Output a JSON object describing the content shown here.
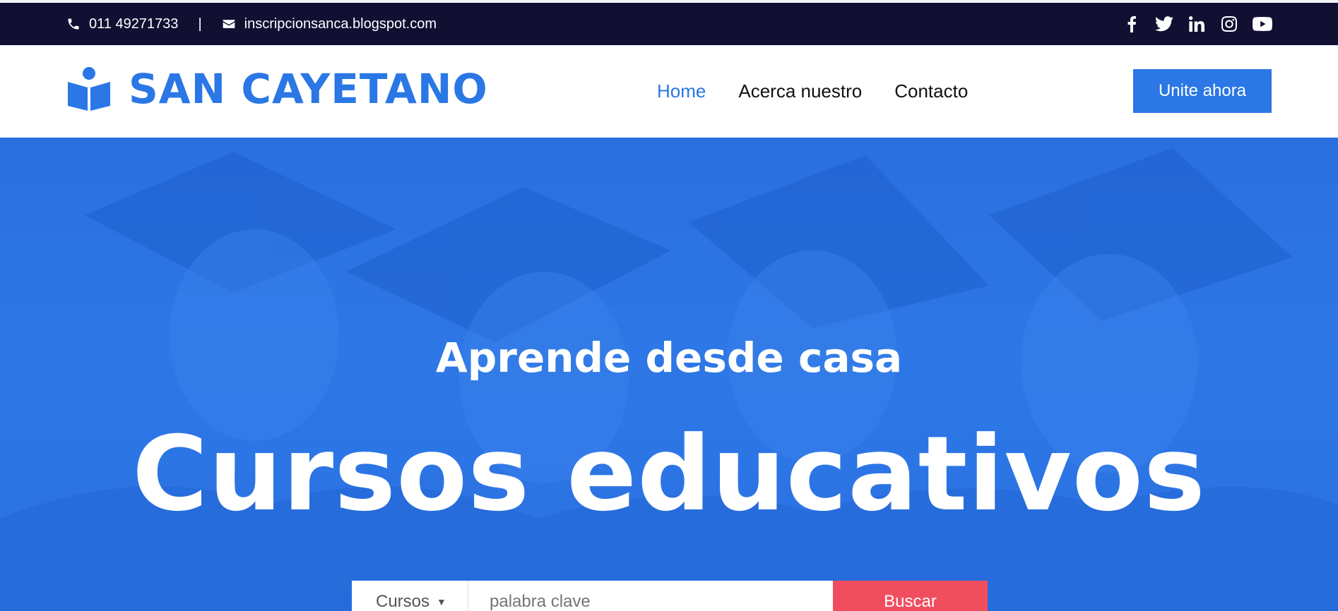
{
  "topbar": {
    "phone": "011 49271733",
    "separator": "|",
    "email": "inscripcionsanca.blogspot.com",
    "social_icons": [
      "facebook-icon",
      "twitter-icon",
      "linkedin-icon",
      "instagram-icon",
      "youtube-icon"
    ]
  },
  "header": {
    "brand": "SAN CAYETANO",
    "logo_icon": "reader-book-icon",
    "nav": [
      {
        "label": "Home",
        "active": true
      },
      {
        "label": "Acerca nuestro",
        "active": false
      },
      {
        "label": "Contacto",
        "active": false
      }
    ],
    "cta_label": "Unite ahora"
  },
  "hero": {
    "subtitle": "Aprende desde casa",
    "title": "Cursos educativos",
    "search": {
      "category_label": "Cursos",
      "placeholder": "palabra clave",
      "button_label": "Buscar"
    }
  },
  "colors": {
    "topbar_bg": "#111033",
    "brand_blue": "#2a77e5",
    "hero_overlay": "#2e77e6",
    "search_button": "#f04e5f"
  }
}
